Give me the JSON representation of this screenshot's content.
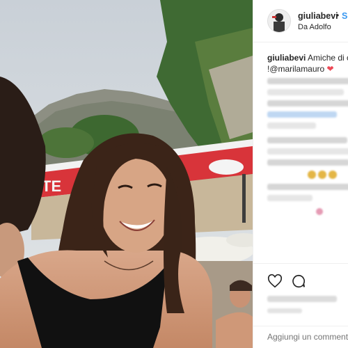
{
  "post": {
    "username": "giuliabevi",
    "separator": "•",
    "follow_label": "Se",
    "location": "Da Adolfo"
  },
  "caption": {
    "username": "giuliabevi",
    "text": "Amiche di c",
    "mention": "!@marilamauro",
    "heart_icon": "red-heart"
  },
  "actions": {
    "like_icon": "heart-outline-icon",
    "comment_icon": "comment-bubble-icon"
  },
  "comment_box": {
    "placeholder": "Aggiungi un commento..."
  },
  "colors": {
    "link": "#3897f0",
    "heart": "#ed4956",
    "text": "#262626"
  }
}
